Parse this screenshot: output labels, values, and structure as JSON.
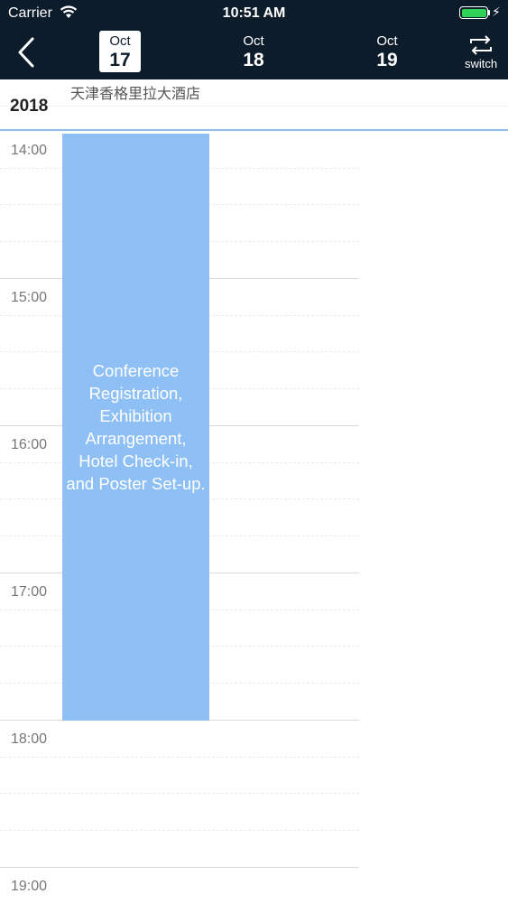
{
  "status_bar": {
    "carrier": "Carrier",
    "time": "10:51 AM",
    "battery_level": 1.0,
    "battery_color": "#2fd158",
    "icons": [
      "wifi-icon",
      "battery-icon",
      "charging-bolt-icon"
    ]
  },
  "nav": {
    "back_icon": "chevron-left-icon",
    "days": [
      {
        "month": "Oct",
        "day": "17",
        "selected": true
      },
      {
        "month": "Oct",
        "day": "18",
        "selected": false
      },
      {
        "month": "Oct",
        "day": "19",
        "selected": false
      }
    ],
    "switch_icon": "repeat-arrows-icon",
    "switch_label": "switch"
  },
  "header": {
    "year": "2018",
    "venue": "天津香格里拉大酒店"
  },
  "timeline": {
    "hours": [
      "14:00",
      "15:00",
      "16:00",
      "17:00",
      "18:00",
      "19:00"
    ]
  },
  "events": [
    {
      "title": "Conference Registration, Exhibition Arrangement, Hotel Check-in, and Poster Set-up.",
      "start": "14:00",
      "end": "18:00"
    }
  ],
  "colors": {
    "nav_background": "#0d1c2b",
    "event_fill": "#8ec0f5",
    "accent_line": "#8cbef0"
  }
}
